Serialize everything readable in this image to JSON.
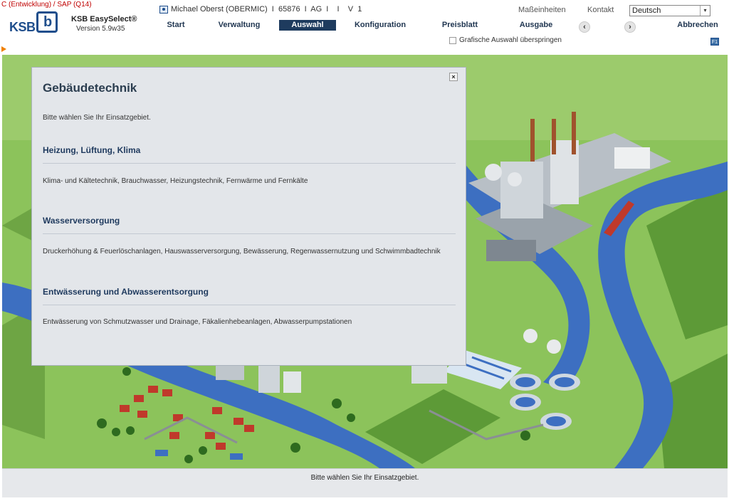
{
  "env_label": "C (Entwicklung) / SAP (Q14)",
  "app": {
    "logo_text": "KSB",
    "logo_mark": "b",
    "name": "KSB EasySelect®",
    "version": "Version 5.9w35"
  },
  "user": {
    "icon": "user-card-icon",
    "text": "Michael Oberst (OBERMIC)  I  65876  I  AG  I    I    V  1"
  },
  "top_links": {
    "units": "Maßeinheiten",
    "contact": "Kontakt"
  },
  "language": {
    "selected": "Deutsch",
    "arrow": "▾"
  },
  "nav": {
    "start": "Start",
    "verwaltung": "Verwaltung",
    "auswahl": "Auswahl",
    "konfiguration": "Konfiguration",
    "preisblatt": "Preisblatt",
    "ausgabe": "Ausgabe",
    "back": "‹",
    "forward": "›",
    "abbrechen": "Abbrechen"
  },
  "skip_graphic": {
    "label": "Grafische Auswahl überspringen",
    "checked": false
  },
  "help_label": "F1",
  "dialog": {
    "close": "×",
    "title": "Gebäudetechnik",
    "prompt": "Bitte wählen Sie Ihr Einsatzgebiet.",
    "sections": [
      {
        "title": "Heizung, Lüftung, Klima",
        "desc": "Klima- und Kältetechnik, Brauchwasser, Heizungstechnik, Fernwärme und Fernkälte"
      },
      {
        "title": "Wasserversorgung",
        "desc": "Druckerhöhung & Feuerlöschanlagen, Hauswasserversorgung, Bewässerung, Regenwassernutzung und Schwimmbadtechnik"
      },
      {
        "title": "Entwässerung und Abwasserentsorgung",
        "desc": "Entwässerung von Schmutzwasser und Drainage, Fäkalienhebeanlagen, Abwasserpumpstationen"
      }
    ]
  },
  "status": "Bitte wählen Sie Ihr Einsatzgebiet.",
  "colors": {
    "nav_active": "#1e3b5e",
    "brand": "#1f4e8c",
    "water": "#3d6fc1",
    "grass": "#7fb84e",
    "env_text": "#c00000"
  }
}
